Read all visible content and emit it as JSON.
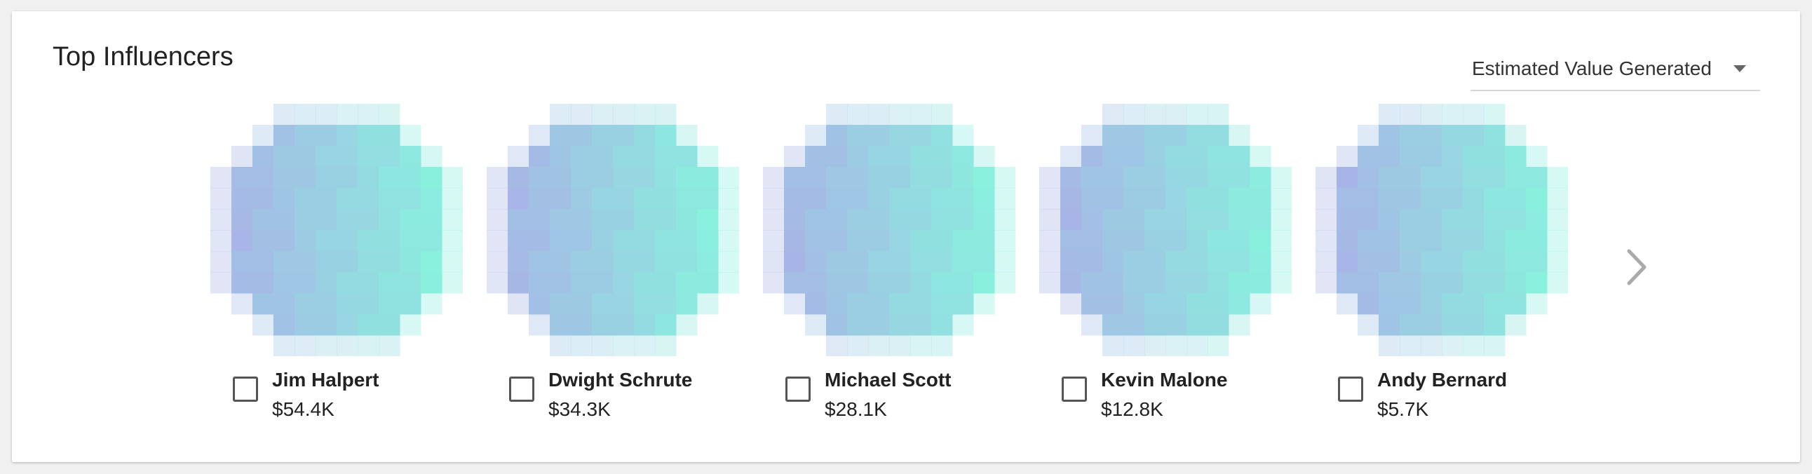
{
  "panel": {
    "title": "Top Influencers"
  },
  "sort_dropdown": {
    "selected": "Estimated Value Generated",
    "icon": "caret-down-icon"
  },
  "influencers": [
    {
      "name": "Jim Halpert",
      "value": "$54.4K",
      "checked": false
    },
    {
      "name": "Dwight Schrute",
      "value": "$34.3K",
      "checked": false
    },
    {
      "name": "Michael Scott",
      "value": "$28.1K",
      "checked": false
    },
    {
      "name": "Kevin Malone",
      "value": "$12.8K",
      "checked": false
    },
    {
      "name": "Andy Bernard",
      "value": "$5.7K",
      "checked": false
    }
  ],
  "carousel": {
    "next_icon": "chevron-right-icon"
  },
  "colors": {
    "avatar_left": "#a8b4e6",
    "avatar_right": "#88f2de",
    "text": "#222222",
    "arrow": "#aaaaaa"
  }
}
